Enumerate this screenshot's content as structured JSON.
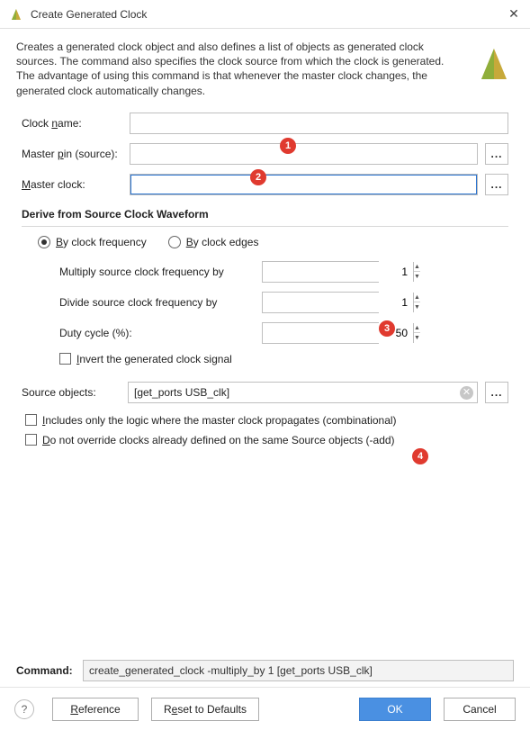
{
  "window": {
    "title": "Create Generated Clock",
    "description": "Creates a generated clock object and also defines a list of objects as generated clock sources. The command also specifies the clock source from which the clock is generated. The advantage of using this command is that whenever the master clock changes, the generated clock automatically changes."
  },
  "fields": {
    "clock_name": {
      "label_pre": "Clock ",
      "label_acc": "n",
      "label_post": "ame:",
      "value": ""
    },
    "master_pin": {
      "label_pre": "Master ",
      "label_acc": "p",
      "label_post": "in (source):",
      "value": ""
    },
    "master_clock": {
      "label_acc": "M",
      "label_post": "aster clock:",
      "value": ""
    }
  },
  "derive": {
    "section_title": "Derive from Source Clock Waveform",
    "radio_freq": {
      "acc": "B",
      "post": "y clock frequency",
      "checked": true
    },
    "radio_edge": {
      "acc": "B",
      "post": "y clock edges",
      "checked": false
    },
    "multiply": {
      "label": "Multiply source clock frequency by",
      "value": "1"
    },
    "divide": {
      "label": "Divide source clock frequency by",
      "value": "1"
    },
    "duty": {
      "label": "Duty cycle (%):",
      "value": "50"
    },
    "invert": {
      "acc": "I",
      "post": "nvert the generated clock signal",
      "checked": false
    }
  },
  "source_objects": {
    "label": "Source objects:",
    "value": "[get_ports USB_clk]"
  },
  "opts": {
    "combinational": {
      "acc": "I",
      "post": "ncludes only the logic where the master clock propagates (combinational)",
      "checked": false
    },
    "noadd": {
      "acc": "D",
      "post": "o not override clocks already defined on the same Source objects (-add)",
      "checked": false
    }
  },
  "command": {
    "label": "Command:",
    "value": "create_generated_clock -multiply_by 1 [get_ports USB_clk]"
  },
  "buttons": {
    "help": "?",
    "reference": {
      "acc": "R",
      "post": "eference"
    },
    "reset": {
      "pre": "R",
      "acc": "e",
      "post": "set to Defaults"
    },
    "ok": "OK",
    "cancel": "Cancel"
  },
  "annotations": {
    "1": "1",
    "2": "2",
    "3": "3",
    "4": "4"
  },
  "dots": "..."
}
